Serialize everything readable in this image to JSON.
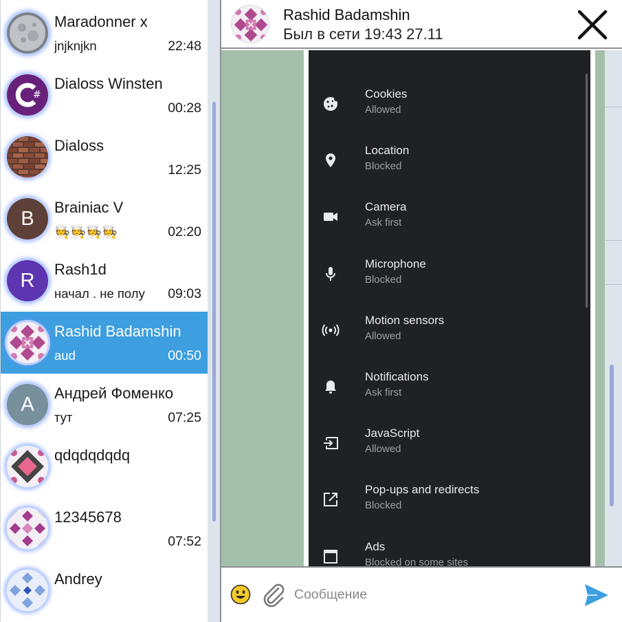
{
  "colors": {
    "accent": "#3d9ee0",
    "chat_background": "#a3bfaa",
    "scrollbar_thumb": "#9aa8d6",
    "phone_background": "#202124",
    "send_icon": "#3d9ee0"
  },
  "chats": [
    {
      "name": "Maradonner x",
      "preview": "jnjknjkn",
      "time": "22:48",
      "avatar_icon": "moon-photo-avatar"
    },
    {
      "name": "Dialoss Winsten",
      "preview": "",
      "time": "00:28",
      "avatar_icon": "csharp-logo-avatar"
    },
    {
      "name": "Dialoss",
      "preview": "",
      "time": "12:25",
      "avatar_icon": "brick-wall-photo-avatar"
    },
    {
      "name": "Brainiac V",
      "preview": "🧑‍🍳🧑‍🍳🧑‍🍳🧑‍🍳",
      "time": "02:20",
      "avatar_icon": "letter-avatar",
      "avatar_letter": "B",
      "avatar_color": "#5d4037"
    },
    {
      "name": "Rash1d",
      "preview": "начал . не полу",
      "time": "09:03",
      "avatar_icon": "letter-avatar",
      "avatar_letter": "R",
      "avatar_color": "#5e35b1"
    },
    {
      "name": "Rashid Badamshin",
      "preview": "aud",
      "time": "00:50",
      "avatar_icon": "identicon-avatar",
      "active": true
    },
    {
      "name": "Андрей Фоменко",
      "preview": "тут",
      "time": "07:25",
      "avatar_icon": "letter-avatar",
      "avatar_letter": "A",
      "avatar_color": "#78909c"
    },
    {
      "name": "qdqdqdqdq",
      "preview": "",
      "time": "",
      "avatar_icon": "identicon-avatar"
    },
    {
      "name": "12345678",
      "preview": "",
      "time": "07:52",
      "avatar_icon": "identicon-avatar"
    },
    {
      "name": "Andrey",
      "preview": "",
      "time": "",
      "avatar_icon": "identicon-avatar"
    }
  ],
  "header": {
    "contact_name": "Rashid Badamshin",
    "status": "Был в сети 19:43 27.11"
  },
  "site_settings": [
    {
      "title": "Cookies",
      "subtitle": "Allowed",
      "icon": "cookie-icon"
    },
    {
      "title": "Location",
      "subtitle": "Blocked",
      "icon": "location-pin-icon"
    },
    {
      "title": "Camera",
      "subtitle": "Ask first",
      "icon": "camera-icon"
    },
    {
      "title": "Microphone",
      "subtitle": "Blocked",
      "icon": "microphone-icon"
    },
    {
      "title": "Motion sensors",
      "subtitle": "Allowed",
      "icon": "motion-sensors-icon"
    },
    {
      "title": "Notifications",
      "subtitle": "Ask first",
      "icon": "bell-icon"
    },
    {
      "title": "JavaScript",
      "subtitle": "Allowed",
      "icon": "javascript-icon"
    },
    {
      "title": "Pop-ups and redirects",
      "subtitle": "Blocked",
      "icon": "popup-icon"
    },
    {
      "title": "Ads",
      "subtitle": "Blocked on some sites",
      "icon": "ads-icon"
    }
  ],
  "composer": {
    "placeholder": "Сообщение"
  }
}
